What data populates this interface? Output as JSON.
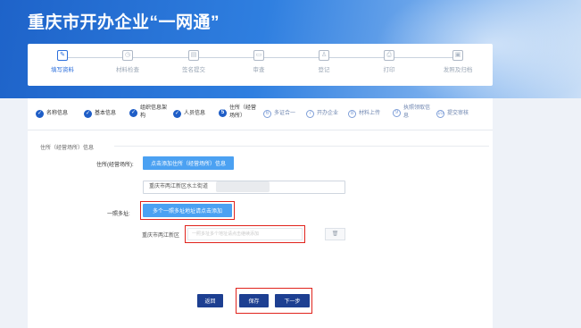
{
  "header": {
    "title": "重庆市开办企业“一网通”"
  },
  "steps": [
    {
      "label": "填写资料",
      "icon": "form-icon",
      "glyph": "✎",
      "active": true
    },
    {
      "label": "材料检查",
      "icon": "clock-icon",
      "glyph": "◷",
      "active": false
    },
    {
      "label": "签名提交",
      "icon": "document-icon",
      "glyph": "▤",
      "active": false
    },
    {
      "label": "审查",
      "icon": "inbox-icon",
      "glyph": "▭",
      "active": false
    },
    {
      "label": "登记",
      "icon": "user-icon",
      "glyph": "♙",
      "active": false
    },
    {
      "label": "打印",
      "icon": "printer-icon",
      "glyph": "⎙",
      "active": false
    },
    {
      "label": "发照及归档",
      "icon": "image-icon",
      "glyph": "▣",
      "active": false
    }
  ],
  "tabs": [
    {
      "num": "✓",
      "line1": "名称信息",
      "line2": "",
      "state": "done"
    },
    {
      "num": "✓",
      "line1": "基本信息",
      "line2": "",
      "state": "done"
    },
    {
      "num": "✓",
      "line1": "组织信息架",
      "line2": "构",
      "state": "done"
    },
    {
      "num": "✓",
      "line1": "人员信息",
      "line2": "",
      "state": "done"
    },
    {
      "num": "5",
      "line1": "住所（经营",
      "line2": "场所）",
      "state": "cur"
    },
    {
      "num": "6",
      "line1": "多证合一",
      "line2": "",
      "state": "todo"
    },
    {
      "num": "7",
      "line1": "开办企业",
      "line2": "",
      "state": "todo"
    },
    {
      "num": "8",
      "line1": "材料上传",
      "line2": "",
      "state": "todo"
    },
    {
      "num": "9",
      "line1": "执照领取信",
      "line2": "息",
      "state": "todo"
    },
    {
      "num": "10",
      "line1": "提交审核",
      "line2": "",
      "state": "todo"
    }
  ],
  "form": {
    "section_title": "住所（经营场所）信息",
    "address_label": "住所(经营场所):",
    "add_address_button": "点击添加住所（经营场所）信息",
    "address_value": "重庆市两江新区水土街道",
    "multi_label": "一照多址:",
    "multi_button": "多个一照多址地址请点击添加",
    "district_label": "重庆市两江新区",
    "detail_placeholder": "一照多址多个地址请点击继续添加",
    "delete_icon": "trash-icon"
  },
  "actions": {
    "back": "返回",
    "save": "保存",
    "next": "下一步"
  },
  "colors": {
    "accent": "#1d3f91",
    "primary": "#4ba1f2",
    "highlight": "#e0231c"
  }
}
